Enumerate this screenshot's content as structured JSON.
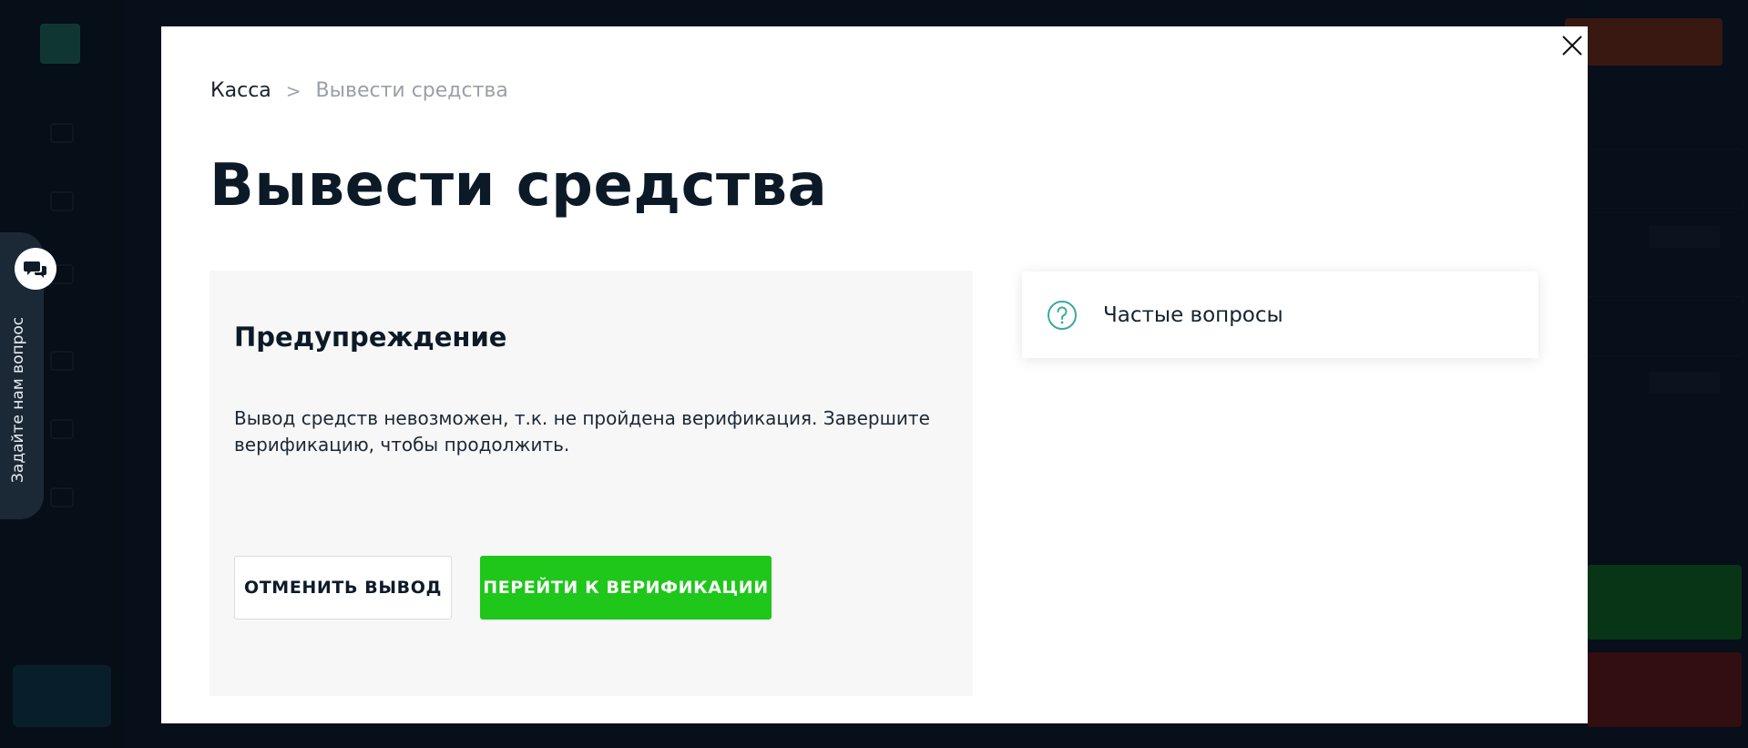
{
  "modal": {
    "breadcrumb": {
      "root": "Касса",
      "separator": ">",
      "current": "Вывести средства"
    },
    "title": "Вывести средства",
    "warning": {
      "title": "Предупреждение",
      "message": "Вывод средств невозможен, т.к. не пройдена верификация. Завершите верификацию, чтобы продолжить.",
      "cancel_label": "ОТМЕНИТЬ ВЫВОД",
      "verify_label": "ПЕРЕЙТИ К ВЕРИФИКАЦИИ"
    },
    "faq": {
      "label": "Частые вопросы",
      "icon": "question-circle-icon"
    },
    "close_icon": "close-icon"
  },
  "ask_tab": {
    "label": "Задайте нам вопрос",
    "icon": "chat-bubbles-icon"
  },
  "colors": {
    "verify_button": "#1ec71a",
    "faq_icon": "#3aa9a0",
    "title": "#0c1a28",
    "background": "#0c1824"
  }
}
